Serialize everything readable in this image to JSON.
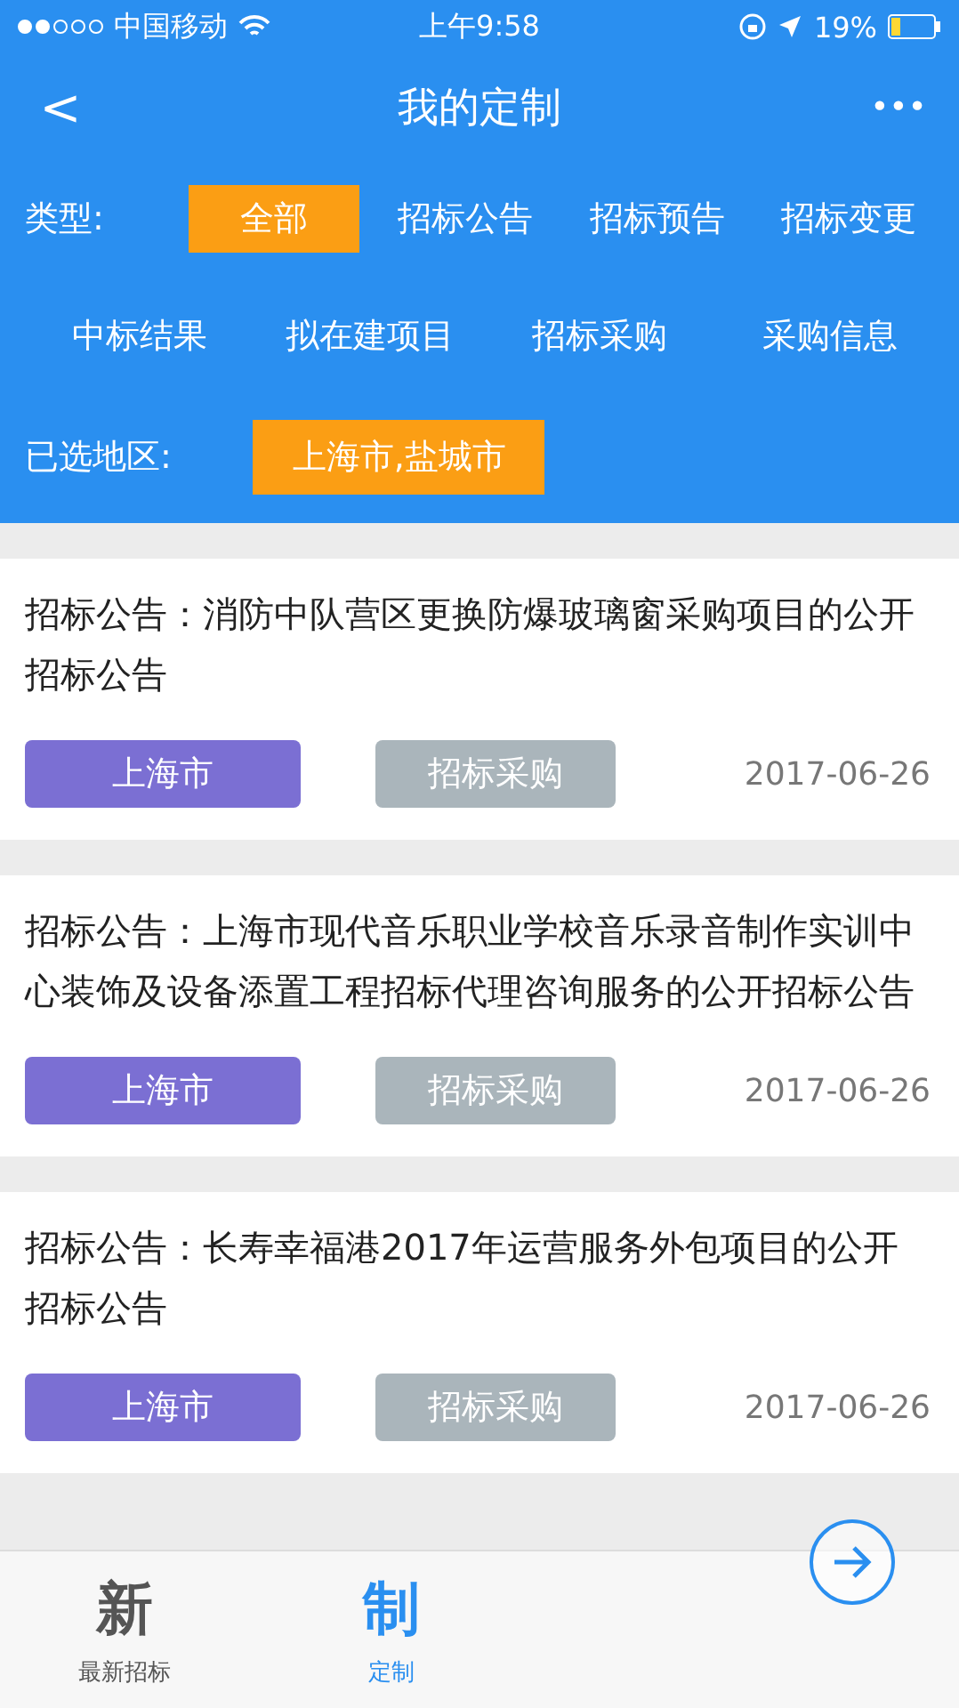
{
  "status_bar": {
    "carrier": "中国移动",
    "time": "上午9:58",
    "battery": "19%"
  },
  "header": {
    "title": "我的定制",
    "back": "<",
    "more": "•••"
  },
  "filters": {
    "type_label": "类型:",
    "types": [
      {
        "label": "全部",
        "selected": true
      },
      {
        "label": "招标公告",
        "selected": false
      },
      {
        "label": "招标预告",
        "selected": false
      },
      {
        "label": "招标变更",
        "selected": false
      },
      {
        "label": "中标结果",
        "selected": false
      },
      {
        "label": "拟在建项目",
        "selected": false
      },
      {
        "label": "招标采购",
        "selected": false
      },
      {
        "label": "采购信息",
        "selected": false
      }
    ],
    "region_label": "已选地区:",
    "region": "上海市,盐城市"
  },
  "items": [
    {
      "title": "招标公告：消防中队营区更换防爆玻璃窗采购项目的公开招标公告",
      "region": "上海市",
      "category": "招标采购",
      "date": "2017-06-26"
    },
    {
      "title": "招标公告：上海市现代音乐职业学校音乐录音制作实训中心装饰及设备添置工程招标代理咨询服务的公开招标公告",
      "region": "上海市",
      "category": "招标采购",
      "date": "2017-06-26"
    },
    {
      "title": "招标公告：长寿幸福港2017年运营服务外包项目的公开招标公告",
      "region": "上海市",
      "category": "招标采购",
      "date": "2017-06-26"
    }
  ],
  "tab_bar": [
    {
      "glyph": "新",
      "label": "最新招标",
      "selected": false
    },
    {
      "glyph": "制",
      "label": "定制",
      "selected": true
    }
  ]
}
